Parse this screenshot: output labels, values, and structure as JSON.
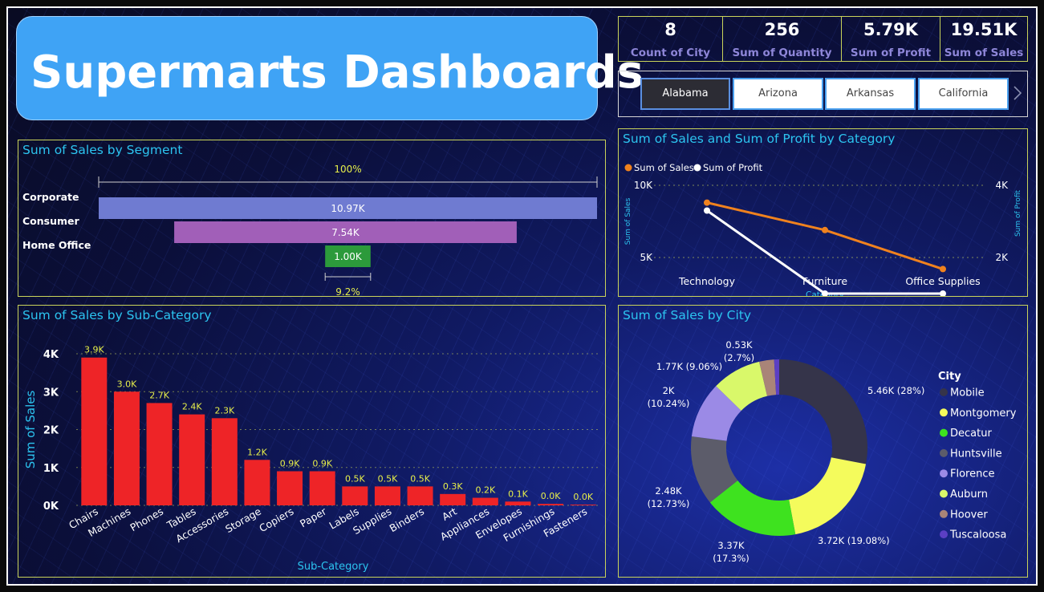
{
  "dashboard": {
    "title": "Supermarts Dashboards",
    "kpis": [
      {
        "value": "8",
        "label": "Count of City"
      },
      {
        "value": "256",
        "label": "Sum of Quantity"
      },
      {
        "value": "5.79K",
        "label": "Sum of Profit"
      },
      {
        "value": "19.51K",
        "label": "Sum of Sales"
      }
    ],
    "state_slicer": {
      "options": [
        "Alabama",
        "Arizona",
        "Arkansas",
        "California"
      ],
      "selected": "Alabama",
      "next_icon": "chevron-right-icon"
    }
  },
  "chart_data": [
    {
      "id": "segment",
      "type": "bar",
      "orientation": "horizontal",
      "title": "Sum of Sales by Segment",
      "categories": [
        "Corporate",
        "Consumer",
        "Home Office"
      ],
      "values": [
        10970,
        7540,
        1000
      ],
      "data_labels": [
        "10.97K",
        "7.54K",
        "1.00K"
      ],
      "colors": [
        "#6f7bd1",
        "#a15fb8",
        "#2c9a3b"
      ],
      "top_annotation": "100%",
      "bottom_annotation": "9.2%"
    },
    {
      "id": "category",
      "type": "line",
      "title": "Sum of Sales and Sum of Profit by Category",
      "categories": [
        "Technology",
        "Furniture",
        "Office Supplies"
      ],
      "xlabel": "Category",
      "ylabel": "Sum of Sales",
      "ylabel_right": "Sum of Profit",
      "series": [
        {
          "name": "Sum of Sales",
          "values": [
            8800,
            6900,
            4200
          ],
          "color": "#f0821e",
          "axis": "left"
        },
        {
          "name": "Sum of Profit",
          "values": [
            3300,
            1000,
            1000
          ],
          "color": "#ffffff",
          "axis": "right"
        }
      ],
      "left_ticks": [
        "10K",
        "5K"
      ],
      "right_ticks": [
        "4K",
        "2K"
      ],
      "left_range": [
        5000,
        10000
      ],
      "right_range": [
        2000,
        4000
      ],
      "legend": "top-left",
      "grid": true
    },
    {
      "id": "subcategory",
      "type": "bar",
      "title": "Sum of Sales by Sub-Category",
      "xlabel": "Sub-Category",
      "ylabel": "Sum of Sales",
      "categories": [
        "Chairs",
        "Machines",
        "Phones",
        "Tables",
        "Accessories",
        "Storage",
        "Copiers",
        "Paper",
        "Labels",
        "Supplies",
        "Binders",
        "Art",
        "Appliances",
        "Envelopes",
        "Furnishings",
        "Fasteners"
      ],
      "values": [
        3900,
        3000,
        2700,
        2400,
        2300,
        1200,
        900,
        900,
        500,
        500,
        500,
        300,
        200,
        100,
        40,
        20
      ],
      "data_labels": [
        "3.9K",
        "3.0K",
        "2.7K",
        "2.4K",
        "2.3K",
        "1.2K",
        "0.9K",
        "0.9K",
        "0.5K",
        "0.5K",
        "0.5K",
        "0.3K",
        "0.2K",
        "0.1K",
        "0.0K",
        "0.0K"
      ],
      "y_ticks": [
        "0K",
        "1K",
        "2K",
        "3K",
        "4K"
      ],
      "ylim": [
        0,
        4000
      ],
      "color": "#ee2427",
      "grid": true
    },
    {
      "id": "city",
      "type": "pie",
      "subtype": "donut",
      "title": "Sum of Sales by City",
      "legend_title": "City",
      "legend": "right",
      "labels": [
        "Mobile",
        "Montgomery",
        "Decatur",
        "Huntsville",
        "Florence",
        "Auburn",
        "Hoover",
        "Tuscaloosa"
      ],
      "values": [
        5460,
        3720,
        3370,
        2480,
        2000,
        1770,
        530,
        180
      ],
      "percents": [
        28,
        19.08,
        17.3,
        12.73,
        10.24,
        9.06,
        2.7,
        0.9
      ],
      "colors": [
        "#35344a",
        "#f4fb5c",
        "#3ee21f",
        "#5c5c6a",
        "#9b8ae6",
        "#d9f86a",
        "#a98478",
        "#5b3fc4"
      ],
      "data_labels": [
        "5.46K (28%)",
        "3.72K (19.08%)",
        "3.37K (17.3%)",
        "2.48K (12.73%)",
        "2K (10.24%)",
        "1.77K (9.06%)",
        "0.53K (2.7%)"
      ]
    }
  ]
}
